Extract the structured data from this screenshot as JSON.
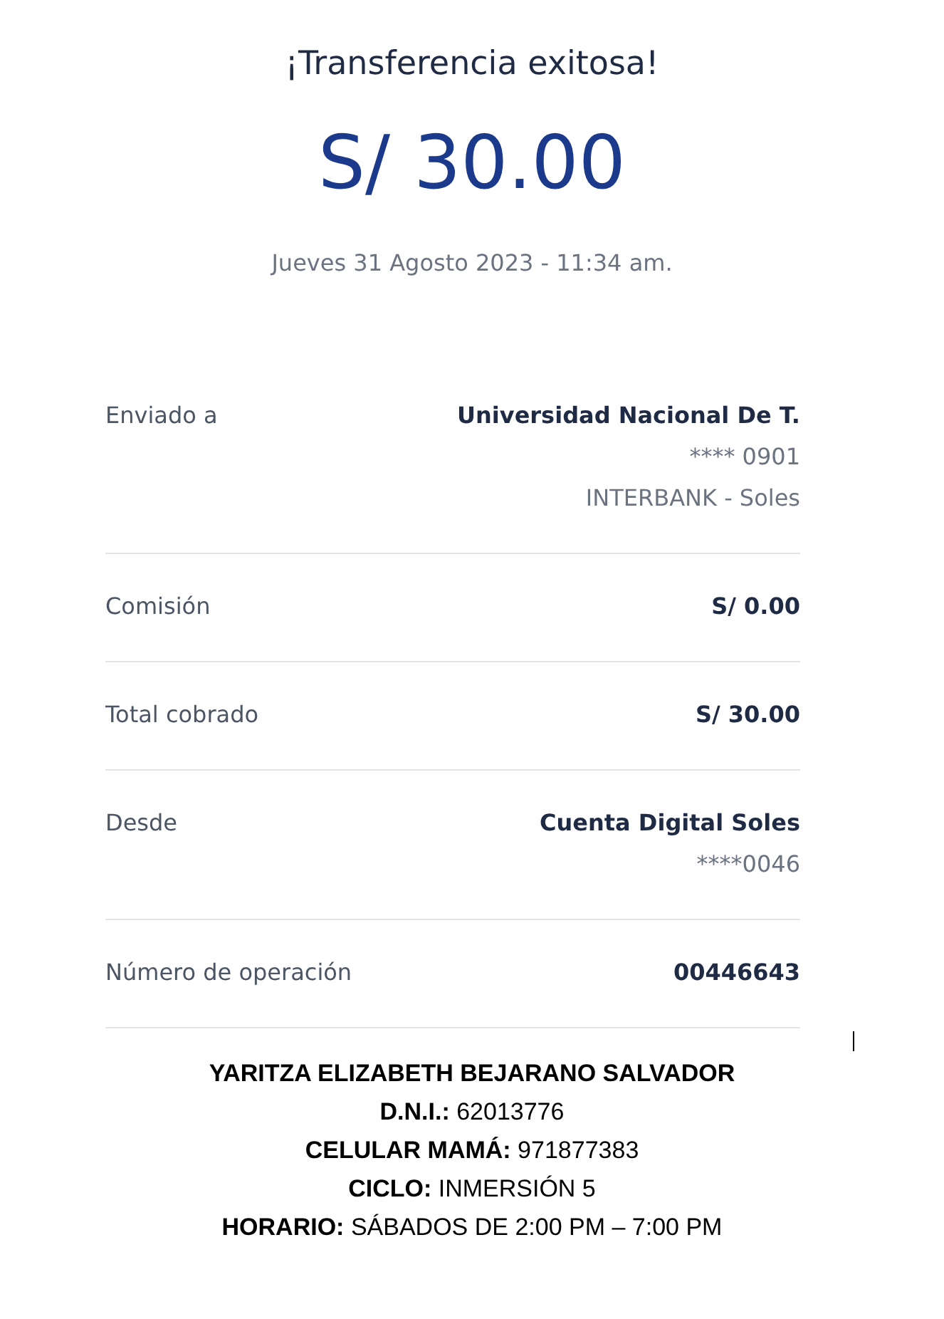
{
  "title": "¡Transferencia exitosa!",
  "amount": "S/ 30.00",
  "date": "Jueves 31 Agosto 2023 - 11:34 am.",
  "details": [
    {
      "label": "Enviado a",
      "values": [
        "Universidad Nacional De T.",
        "**** 0901",
        "INTERBANK - Soles"
      ]
    },
    {
      "label": "Comisión",
      "values": [
        "S/ 0.00"
      ]
    },
    {
      "label": "Total cobrado",
      "values": [
        "S/ 30.00"
      ]
    },
    {
      "label": "Desde",
      "values": [
        "Cuenta Digital Soles",
        "****0046"
      ]
    },
    {
      "label": "Número de operación",
      "values": [
        "00446643"
      ]
    }
  ],
  "notes": [
    {
      "label": "YARITZA ELIZABETH BEJARANO SALVADOR"
    },
    {
      "label": "D.N.I.:",
      "value": "62013776"
    },
    {
      "label": "CELULAR MAMÁ:",
      "value": "971877383"
    },
    {
      "label": "CICLO:",
      "value": "INMERSIÓN 5"
    },
    {
      "label": "HORARIO:",
      "value": "SÁBADOS DE 2:00 PM – 7:00 PM"
    }
  ]
}
